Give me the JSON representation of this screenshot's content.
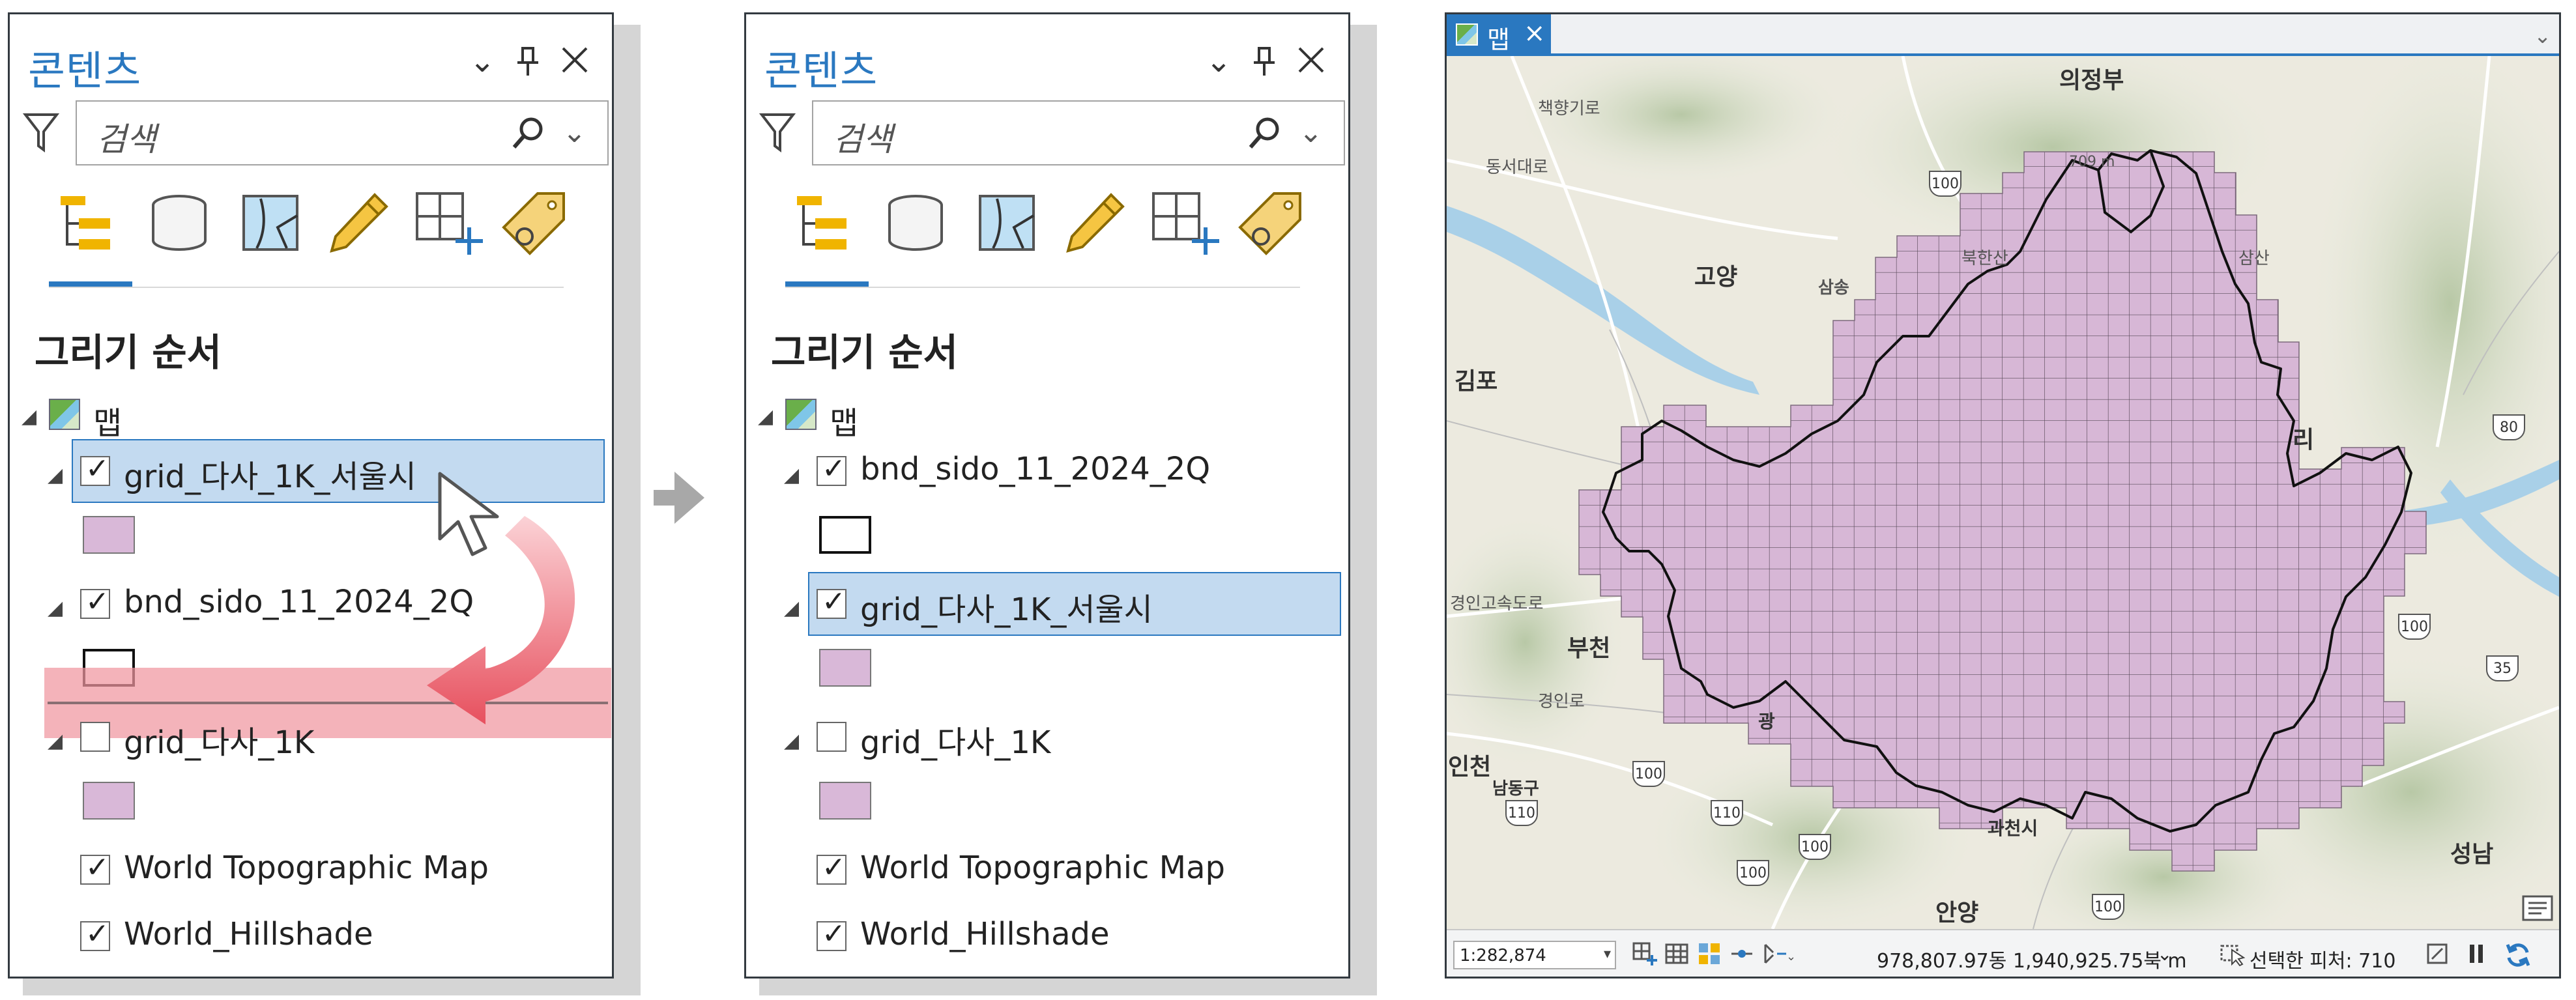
{
  "panels": {
    "title": "콘텐츠",
    "search_placeholder": "검색",
    "section_title": "그리기 순서",
    "map_label": "맵"
  },
  "panel_before": {
    "layers": [
      {
        "name": "grid_다사_1K_서울시",
        "checked": true,
        "selected": true
      },
      {
        "name": "bnd_sido_11_2024_2Q",
        "checked": true,
        "selected": false
      },
      {
        "name": "grid_다사_1K",
        "checked": false,
        "selected": false
      },
      {
        "name": "World Topographic Map",
        "checked": true
      },
      {
        "name": "World_Hillshade",
        "checked": true
      }
    ]
  },
  "panel_after": {
    "layers": [
      {
        "name": "bnd_sido_11_2024_2Q",
        "checked": true,
        "selected": false
      },
      {
        "name": "grid_다사_1K_서울시",
        "checked": true,
        "selected": true
      },
      {
        "name": "grid_다사_1K",
        "checked": false,
        "selected": false
      },
      {
        "name": "World Topographic Map",
        "checked": true
      },
      {
        "name": "World_Hillshade",
        "checked": true
      }
    ]
  },
  "map_window": {
    "tab_label": "맵",
    "places": {
      "uijeongbu": "의정부",
      "goyang": "고양",
      "gimpo": "김포",
      "bucheon": "부천",
      "incheon": "인천",
      "seongnam": "성남",
      "anyang": "안양",
      "gwacheon": "과천시",
      "namdonggu": "남동구",
      "guri": "리",
      "gwang": "광",
      "chaekhyang": "책향기로",
      "dongseodaero": "동서대로",
      "bukhansan": "북한산",
      "samsong": "삼송",
      "gyeongin": "경인고속도로",
      "gyeonginro": "경인로",
      "sulsan": "삼산",
      "m709": "709 m"
    },
    "shields": [
      "100",
      "100",
      "100",
      "100",
      "110",
      "110",
      "100",
      "100",
      "35",
      "80"
    ],
    "status": {
      "scale": "1:282,874",
      "coords": "978,807.97동 1,940,925.75북 m",
      "selected_features": "선택한 피처: 710"
    }
  },
  "colors": {
    "accent": "#2a78c0",
    "selection": "#c3daf0",
    "grid_fill": "#d9b8d8",
    "drop_band": "#f096a0"
  }
}
